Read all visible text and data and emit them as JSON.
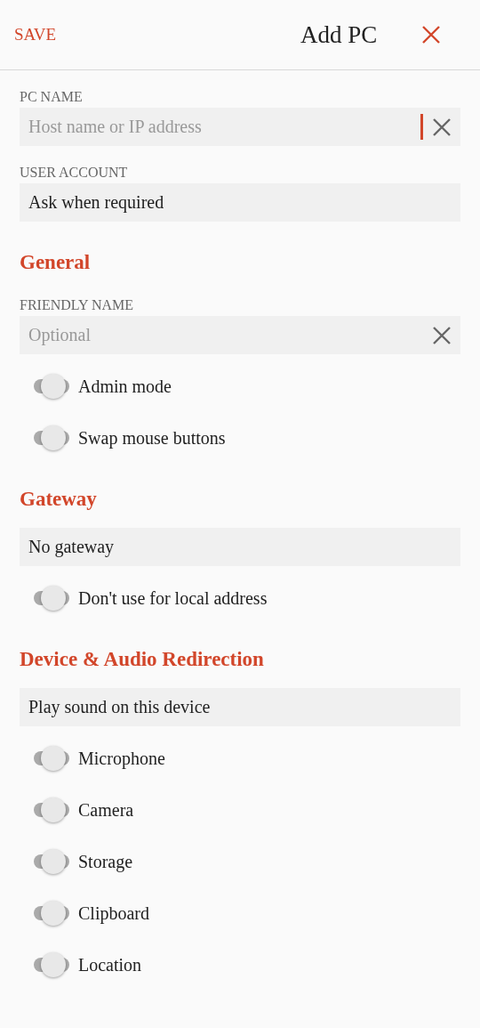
{
  "header": {
    "save": "SAVE",
    "title": "Add PC"
  },
  "items": [
    {
      "kind": "label",
      "text": "PC NAME"
    },
    {
      "kind": "text_field",
      "placeholder": "Host name or IP address",
      "focused": true
    },
    {
      "kind": "label",
      "text": "USER ACCOUNT"
    },
    {
      "kind": "dropdown",
      "value": "Ask when required"
    },
    {
      "kind": "heading",
      "text": "General"
    },
    {
      "kind": "label",
      "text": "FRIENDLY NAME"
    },
    {
      "kind": "text_field",
      "placeholder": "Optional",
      "focused": false
    },
    {
      "kind": "toggle",
      "label": "Admin mode",
      "on": false
    },
    {
      "kind": "toggle",
      "label": "Swap mouse buttons",
      "on": false
    },
    {
      "kind": "heading",
      "text": "Gateway"
    },
    {
      "kind": "dropdown",
      "value": "No gateway"
    },
    {
      "kind": "toggle",
      "label": "Don't use for local address",
      "on": false
    },
    {
      "kind": "heading",
      "text": "Device & Audio Redirection"
    },
    {
      "kind": "dropdown",
      "value": "Play sound on this device"
    },
    {
      "kind": "toggle",
      "label": "Microphone",
      "on": false
    },
    {
      "kind": "toggle",
      "label": "Camera",
      "on": false
    },
    {
      "kind": "toggle",
      "label": "Storage",
      "on": false
    },
    {
      "kind": "toggle",
      "label": "Clipboard",
      "on": false
    },
    {
      "kind": "toggle",
      "label": "Location",
      "on": false
    }
  ]
}
